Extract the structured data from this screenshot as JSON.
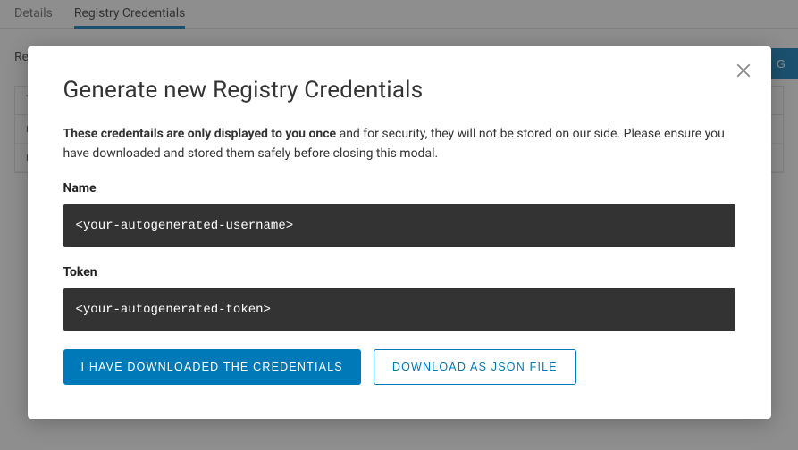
{
  "tabs": {
    "details": "Details",
    "registry": "Registry Credentials"
  },
  "page": {
    "section_label_prefix": "Reg",
    "generate_button": "G",
    "table_header": "T",
    "row1": "ro\na",
    "row2": "ro\ns"
  },
  "modal": {
    "title": "Generate new Registry Credentials",
    "desc_bold": "These credentails are only displayed to you once",
    "desc_rest": " and for security, they will not be stored on our side. Please ensure you have downloaded and stored them safely before closing this modal.",
    "name_label": "Name",
    "name_value": "<your-autogenerated-username>",
    "token_label": "Token",
    "token_value": "<your-autogenerated-token>",
    "confirm_button": "I HAVE DOWNLOADED THE CREDENTIALS",
    "download_button": "DOWNLOAD AS JSON FILE"
  }
}
